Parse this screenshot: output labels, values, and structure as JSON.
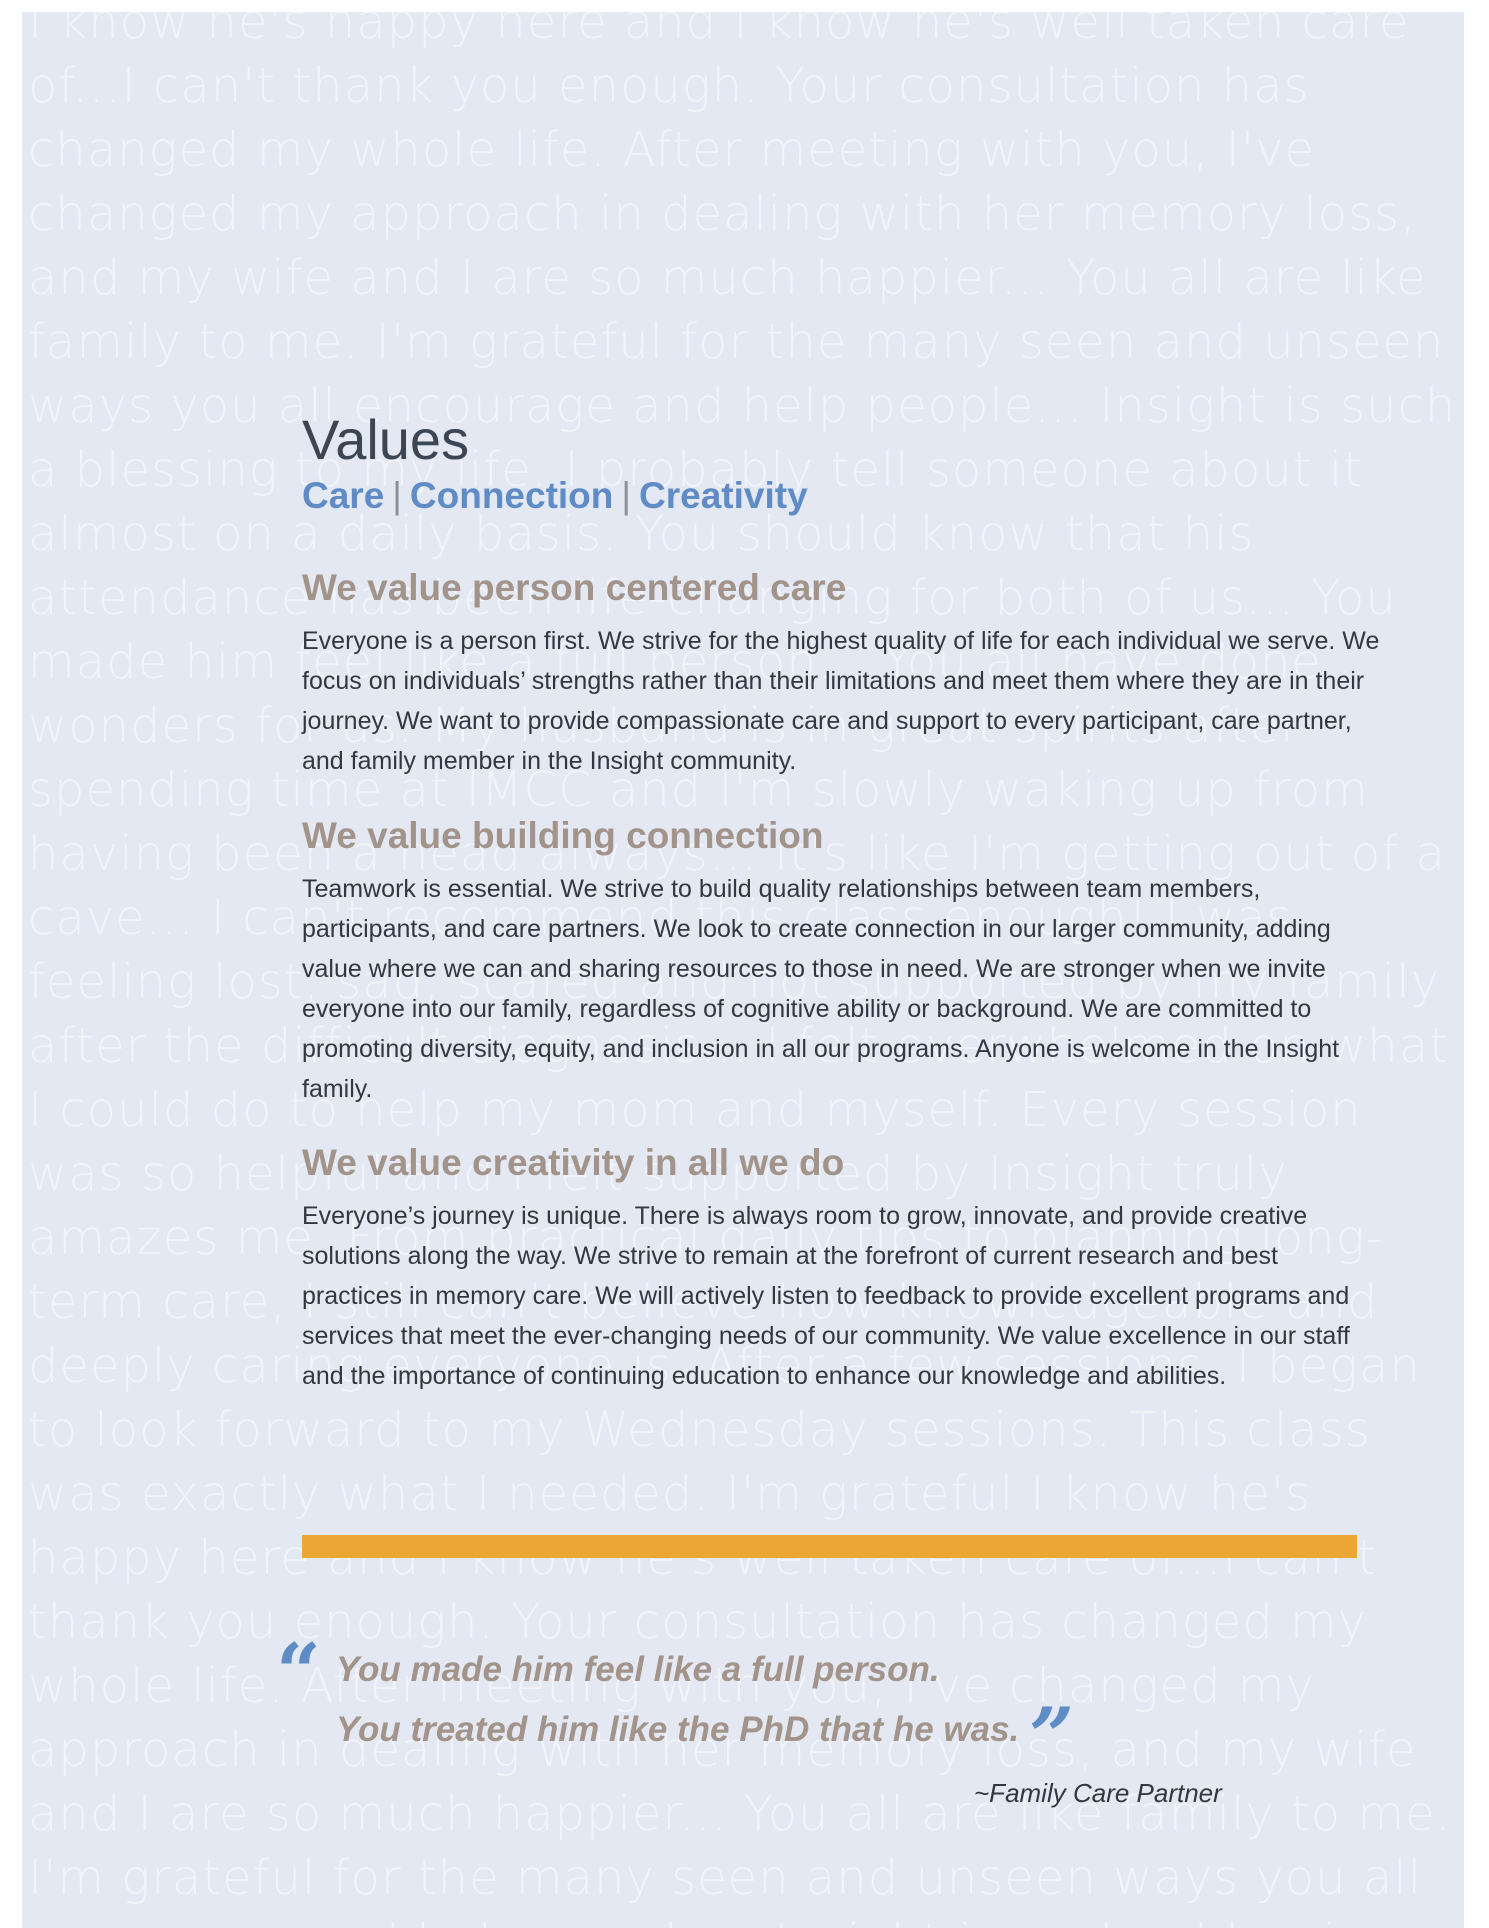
{
  "background_text": "I know he's happy here and I know he's well taken care of...I can't thank you enough. Your consultation has changed my whole life. After meeting with you, I've changed my approach in dealing with her memory loss, and my wife and I are so much happier... You all are like family to me. I'm grateful for the many seen and unseen ways you all encourage and help people... Insight is such a blessing to my life. I probably tell someone about it almost on a daily basis. You should know that his attendance has been life-changing for both of us... You made him feel like a full person... You all have done wonders for us. My husband is in great spirits after spending time at IMCC and I'm slowly waking up from having been a head always... It's like I'm getting out of a cave... I can't recommend this class enough! I was feeling lost, sad, scared and not supported by my family after the difficult diagnosis... I felt overwhelmed on what I could do to help my mom and myself. Every session was so helpful and I felt supported by Insight truly amazes me. From practical daily tips to planning long-term care, I still can't believe how knowledgeable and deeply caring everyone is. After a few sessions, I began to look forward to my Wednesday sessions. This class was exactly what I needed. I'm grateful I know he's happy here and I know he's well taken care of...I can't thank you enough. Your consultation has changed my whole life. After meeting with you, I've changed my approach in dealing with her memory loss, and my wife and I are so much happier... You all are like family to me. I'm grateful for the many seen and unseen ways you all encourage and help people... Insight is such a blessing to my life. I probably tell someone about it almost on a daily basis. You should know that his attendance has been life-changing for both of us...",
  "header": {
    "title": "Values",
    "subtitle_items": [
      "Care",
      "Connection",
      "Creativity"
    ],
    "separator": "|"
  },
  "sections": [
    {
      "heading": "We value person centered care",
      "body": "Everyone is a person first. We strive for the highest quality of life for each individual we serve. We focus on individuals’ strengths rather than their limitations and meet them where they are in their journey. We want to provide compassionate care and support to every participant, care partner, and family member in the Insight community."
    },
    {
      "heading": "We value building connection",
      "body": "Teamwork is essential. We strive to build quality relationships between team members, participants, and care partners. We look to create connection in our larger community, adding value where we can and sharing resources to those in need. We are stronger when we invite everyone into our family, regardless of cognitive ability or background. We are committed to promoting diversity, equity, and inclusion in all our programs. Anyone is welcome in the Insight family."
    },
    {
      "heading": "We value creativity in all we do",
      "body": "Everyone’s journey is unique. There is always room to grow, innovate, and provide creative solutions along the way. We strive to remain at the forefront of current research and best practices in memory care. We will actively listen to feedback to provide excellent programs and services that meet the ever-changing needs of our community. We value excellence in our staff and the importance of continuing education to enhance our knowledge and abilities."
    }
  ],
  "quote": {
    "open_mark": "“",
    "line1": "You made him feel like a full person.",
    "line2": "You treated him like the PhD that he was.",
    "close_mark": "”",
    "attribution": "~Family Care Partner"
  },
  "colors": {
    "page_background": "#e3e8f2",
    "accent_blue": "#5f8bc6",
    "heading_taupe": "#a2948a",
    "body_text": "#323843",
    "divider_orange": "#eca634"
  }
}
